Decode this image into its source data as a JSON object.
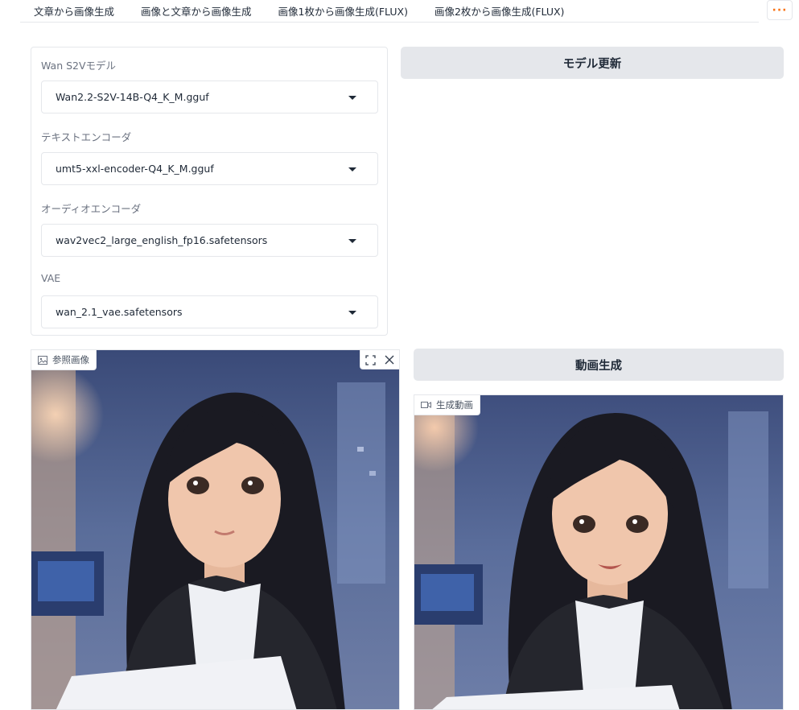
{
  "tabs": [
    {
      "label": "文章から画像生成"
    },
    {
      "label": "画像と文章から画像生成"
    },
    {
      "label": "画像1枚から画像生成(FLUX)"
    },
    {
      "label": "画像2枚から画像生成(FLUX)"
    }
  ],
  "more_button": {
    "label": "···"
  },
  "models": {
    "s2v": {
      "label": "Wan S2Vモデル",
      "value": "Wan2.2-S2V-14B-Q4_K_M.gguf"
    },
    "text_encoder": {
      "label": "テキストエンコーダ",
      "value": "umt5-xxl-encoder-Q4_K_M.gguf"
    },
    "audio_encoder": {
      "label": "オーディオエンコーダ",
      "value": "wav2vec2_large_english_fp16.safetensors"
    },
    "vae": {
      "label": "VAE",
      "value": "wan_2.1_vae.safetensors"
    }
  },
  "buttons": {
    "update_models": "モデル更新",
    "generate_video": "動画生成"
  },
  "reference_image": {
    "label": "参照画像"
  },
  "output_video": {
    "label": "生成動画"
  },
  "colors": {
    "accent": "#f97316",
    "button_bg": "#e5e7eb",
    "border": "#e5e7eb"
  }
}
